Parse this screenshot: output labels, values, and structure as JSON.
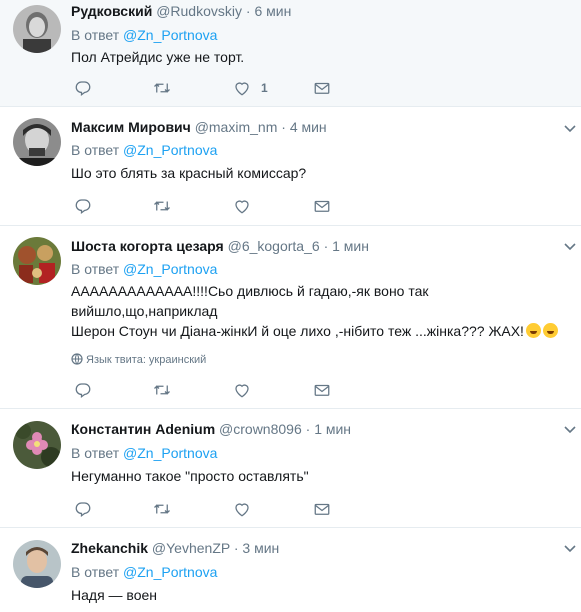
{
  "tweets": [
    {
      "name": "Рудковский",
      "handle": "@Rudkovskiy",
      "dot": "·",
      "time": "6 мин",
      "reply_prefix": "В ответ",
      "reply_to": "@Zn_Portnova",
      "text": "Пол Атрейдис уже не торт.",
      "like_count": "1"
    },
    {
      "name": "Максим Мирович",
      "handle": "@maxim_nm",
      "dot": "·",
      "time": "4 мин",
      "reply_prefix": "В ответ",
      "reply_to": "@Zn_Portnova",
      "text": "Шо это блять за красный комиссар?"
    },
    {
      "name": "Шоста когорта цезаря",
      "handle": "@6_kogorta_6",
      "dot": "·",
      "time": "1 мин",
      "reply_prefix": "В ответ",
      "reply_to": "@Zn_Portnova",
      "text_line1": "ААААААААААААА!!!!Сьо дивлюсь й гадаю,-як воно так вийшло,що,наприклад",
      "text_line2": "Шерон Стоун чи Діана-жінкИ й оце лихо ,-нібито теж ...жінка??? ЖАХ!",
      "language": "Язык твита: украинский"
    },
    {
      "name": "Константин Adenium",
      "handle": "@crown8096",
      "dot": "·",
      "time": "1 мин",
      "reply_prefix": "В ответ",
      "reply_to": "@Zn_Portnova",
      "text": "Негуманно такое \"просто оставлять\""
    },
    {
      "name": "Zhekanchik",
      "handle": "@YevhenZP",
      "dot": "·",
      "time": "3 мин",
      "reply_prefix": "В ответ",
      "reply_to": "@Zn_Portnova",
      "text": "Надя — воен"
    }
  ],
  "icons": {
    "reply": "reply-icon",
    "retweet": "retweet-icon",
    "like": "heart-icon",
    "dm": "envelope-icon",
    "more": "chevron-down-icon"
  },
  "colors": {
    "link": "#1da1f2",
    "muted": "#657786",
    "text": "#14171a",
    "highlight_bg": "#f5f8fa"
  }
}
